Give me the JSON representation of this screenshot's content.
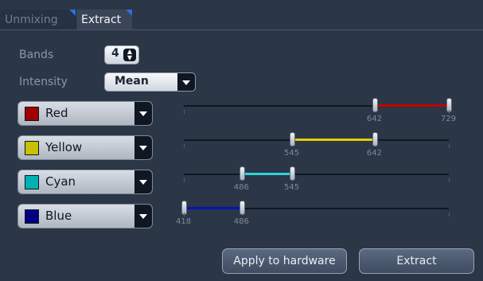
{
  "tabs": [
    {
      "label": "Unmixing"
    },
    {
      "label": "Extract"
    }
  ],
  "bands": {
    "label": "Bands",
    "value": "4"
  },
  "intensity": {
    "label": "Intensity",
    "value": "Mean"
  },
  "channels": [
    {
      "label": "Red",
      "swatch_color": "#a00000",
      "range_color": "#c50000",
      "low": 642,
      "high": 729
    },
    {
      "label": "Yellow",
      "swatch_color": "#c8c000",
      "range_color": "#e0d000",
      "low": 545,
      "high": 642
    },
    {
      "label": "Cyan",
      "swatch_color": "#00b2b2",
      "range_color": "#2bd6da",
      "low": 486,
      "high": 545
    },
    {
      "label": "Blue",
      "swatch_color": "#000080",
      "range_color": "#0015b8",
      "low": 418,
      "high": 486
    }
  ],
  "scale": {
    "min": 418,
    "max": 729
  },
  "buttons": {
    "apply": "Apply to hardware",
    "extract": "Extract"
  },
  "icons": {
    "stepper": "stepper-arrows-icon",
    "dropdown": "chevron-down-icon"
  }
}
